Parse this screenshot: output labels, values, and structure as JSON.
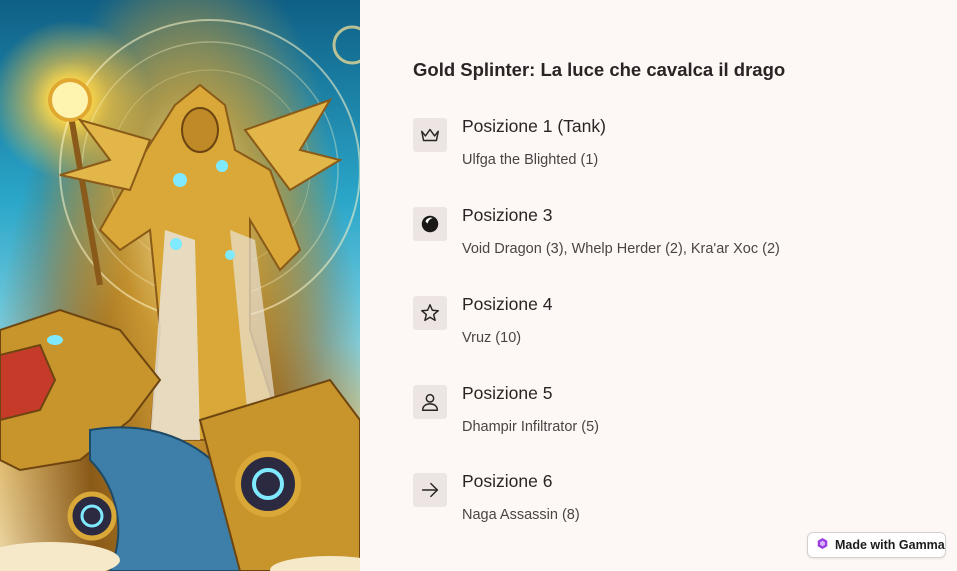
{
  "hero": {
    "alt_icon": "golden-dragon-rider-illustration"
  },
  "title": "Gold Splinter: La luce che cavalca il drago",
  "items": [
    {
      "icon": "crown-icon",
      "title": "Posizione 1 (Tank)",
      "desc": "Ulfga the Blighted (1)"
    },
    {
      "icon": "moon-icon",
      "title": "Posizione 3",
      "desc": "Void Dragon (3), Whelp Herder (2), Kra'ar Xoc (2)"
    },
    {
      "icon": "star-icon",
      "title": "Posizione 4",
      "desc": "Vruz (10)"
    },
    {
      "icon": "person-icon",
      "title": "Posizione 5",
      "desc": "Dhampir Infiltrator (5)"
    },
    {
      "icon": "arrow-right-icon",
      "title": "Posizione 6",
      "desc": "Naga Assassin (8)"
    }
  ],
  "badge": {
    "label": "Made with Gamma",
    "icon": "gamma-logo-icon",
    "color": "#9b3fe0"
  }
}
